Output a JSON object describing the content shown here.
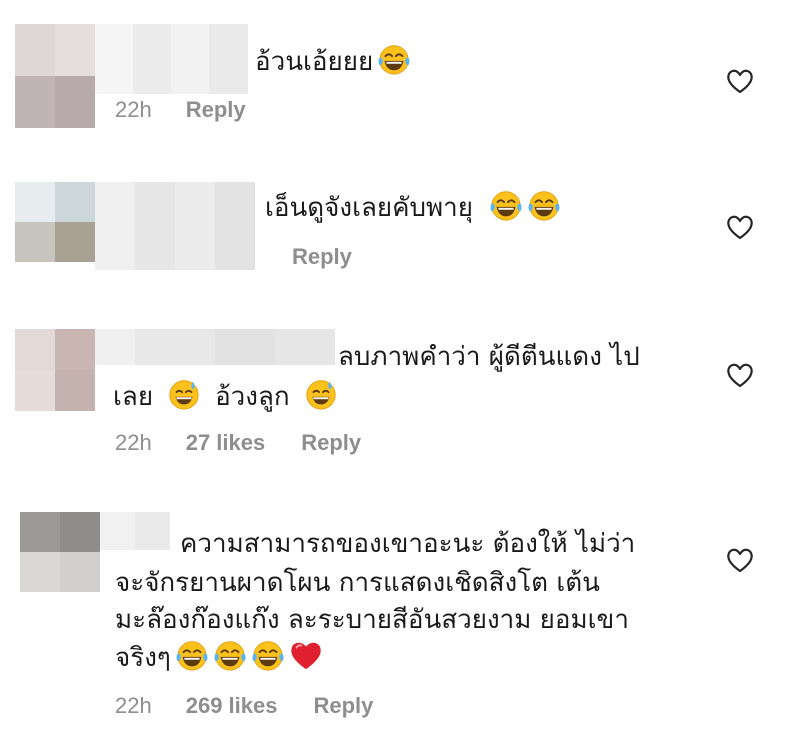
{
  "comments": [
    {
      "text_lines": [
        "อ้วนเอ้ยยย"
      ],
      "emojis": [
        "laugh-cry-emoji"
      ],
      "time": "22h",
      "likes": "",
      "reply": "Reply",
      "heart_icon": "heart-outline-icon"
    },
    {
      "text_lines": [
        "เอ็นดูจังเลยคับพายุ"
      ],
      "emojis": [
        "laugh-cry-emoji",
        "laugh-cry-emoji"
      ],
      "time": "",
      "likes": "",
      "reply": "Reply",
      "heart_icon": "heart-outline-icon"
    },
    {
      "text_lines": [
        "ลบภาพคำว่า ผู้ดีตีนแดง ไป",
        "เลย",
        "อ้วงลูก"
      ],
      "emojis": [
        "sweat-smile-emoji",
        "sweat-smile-emoji"
      ],
      "time": "22h",
      "likes": "27 likes",
      "reply": "Reply",
      "heart_icon": "heart-outline-icon"
    },
    {
      "text_lines": [
        "ความสามารถของเขาอะนะ ต้องให้ ไม่ว่า",
        "จะจักรยานผาดโผน การแสดงเชิดสิงโต เต้น",
        "มะล๊องก๊องแก๊ง ละระบายสีอันสวยงาม ยอมเขา",
        "จริงๆ"
      ],
      "emojis": [
        "laugh-cry-emoji",
        "laugh-cry-emoji",
        "laugh-cry-emoji",
        "red-heart-emoji"
      ],
      "time": "22h",
      "likes": "269 likes",
      "reply": "Reply",
      "heart_icon": "heart-outline-icon"
    }
  ],
  "colors": {
    "meta_text": "#8e8e8e",
    "heart_outline": "#262626",
    "emoji_yellow": "#fcc21b",
    "emoji_red": "#e0202e"
  }
}
